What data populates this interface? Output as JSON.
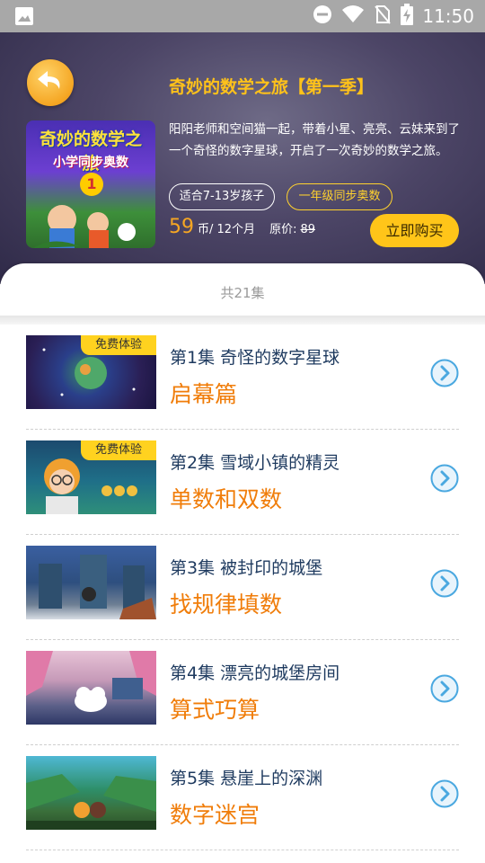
{
  "status_bar": {
    "time": "11:50"
  },
  "course": {
    "title": "奇妙的数学之旅【第一季】",
    "cover_title": "奇妙的数学之旅",
    "cover_subtitle": "小学同步奥数",
    "cover_number": "1",
    "description": "阳阳老师和空间猫一起，带着小星、亮亮、云妹来到了一个奇怪的数字星球，开启了一次奇妙的数学之旅。",
    "tag_age": "适合7-13岁孩子",
    "tag_grade": "一年级同步奥数",
    "price": "59",
    "price_unit": "币/ 12个月",
    "original_label": "原价:",
    "original_price": "89",
    "buy_label": "立即购买"
  },
  "episode_count": "共21集",
  "episodes": [
    {
      "title": "第1集 奇怪的数字星球",
      "subtitle": "启幕篇",
      "badge": "免费体验"
    },
    {
      "title": "第2集 雪域小镇的精灵",
      "subtitle": "单数和双数",
      "badge": "免费体验"
    },
    {
      "title": "第3集 被封印的城堡",
      "subtitle": "找规律填数",
      "badge": ""
    },
    {
      "title": "第4集 漂亮的城堡房间",
      "subtitle": "算式巧算",
      "badge": ""
    },
    {
      "title": "第5集 悬崖上的深渊",
      "subtitle": "数字迷宫",
      "badge": ""
    }
  ],
  "colors": {
    "accent": "#ffc519",
    "subtitle_orange": "#f07d0a",
    "title_navy": "#1e3a5f",
    "arrow_blue": "#4aa8e0"
  }
}
